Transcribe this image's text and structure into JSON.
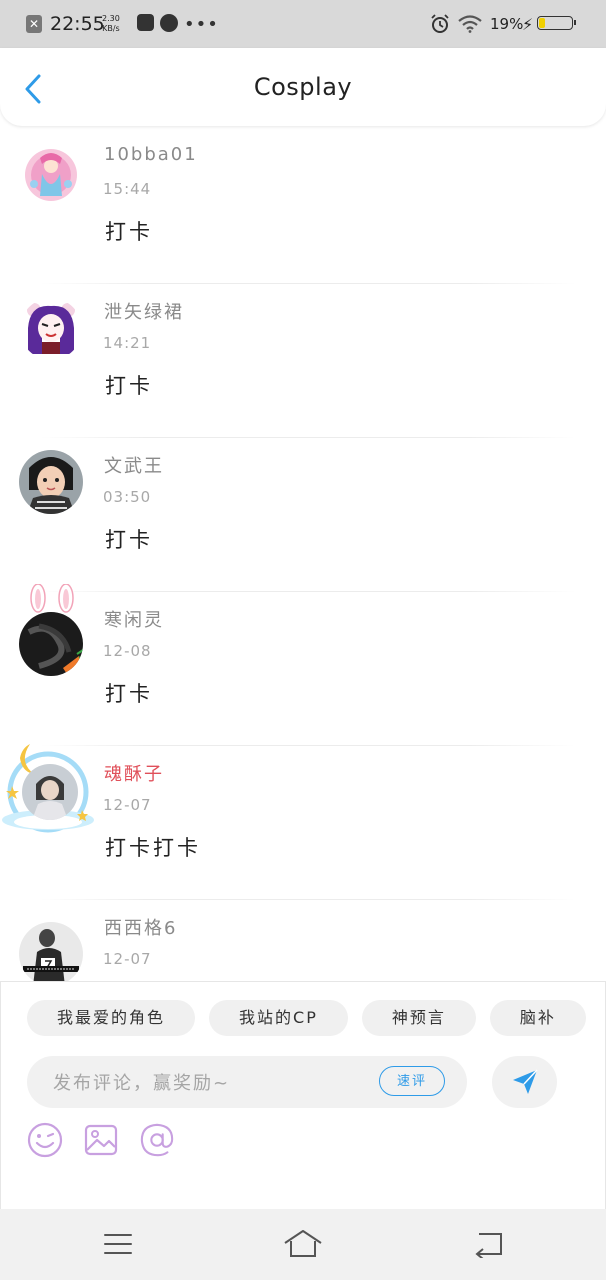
{
  "status_bar": {
    "time": "22:55",
    "speed_value": "2.30",
    "speed_unit": "KB/s",
    "battery_pct": "19%",
    "battery_level": 0.19
  },
  "header": {
    "title": "Cosplay"
  },
  "comments": [
    {
      "username": "10bba01",
      "time": "15:44",
      "text": "打卡"
    },
    {
      "username": "泄矢绿裙",
      "time": "14:21",
      "text": "打卡"
    },
    {
      "username": "文武王",
      "time": "03:50",
      "text": "打卡"
    },
    {
      "username": "寒闲灵",
      "time": "12-08",
      "text": "打卡"
    },
    {
      "username": "魂酥子",
      "time": "12-07",
      "text": "打卡打卡"
    },
    {
      "username": "西西格6",
      "time": "12-07",
      "text": ""
    }
  ],
  "chips": [
    "我最爱的角色",
    "我站的CP",
    "神预言",
    "脑补"
  ],
  "comment_box": {
    "placeholder": "发布评论，赢奖励~",
    "quick_label": "速评"
  },
  "colors": {
    "accent": "#2e9be8",
    "vip_name": "#e0505a",
    "tool_icon": "#c8a0e0"
  }
}
